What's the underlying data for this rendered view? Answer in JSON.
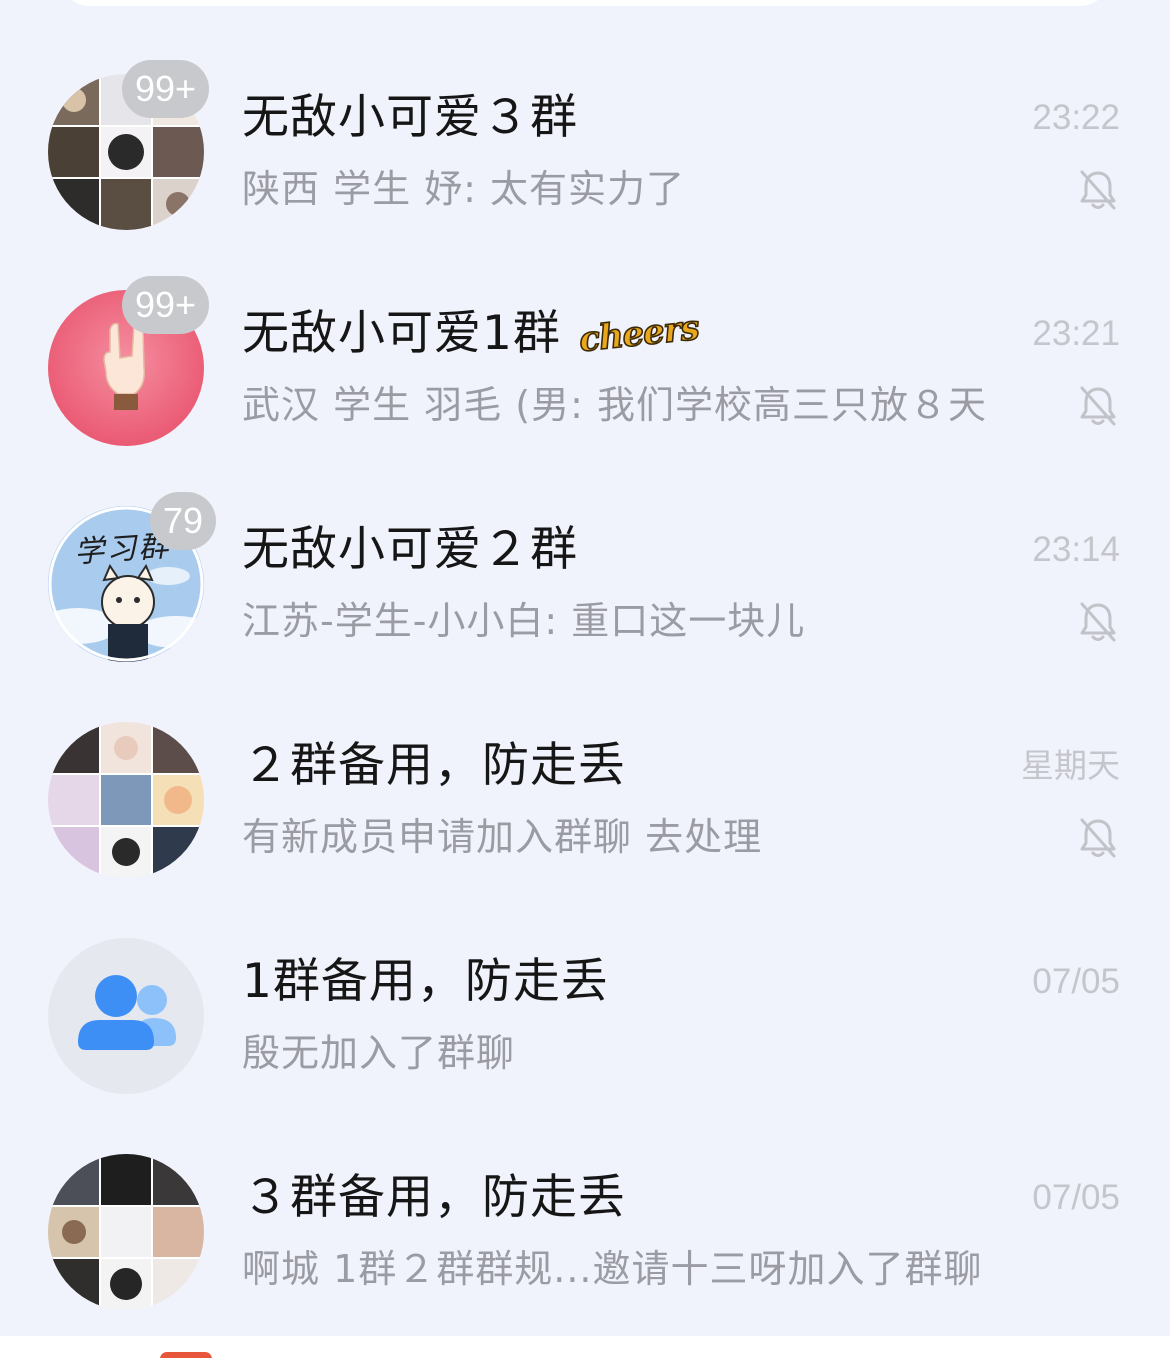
{
  "chats": [
    {
      "title": "无敌小可爱３群",
      "badge": "99+",
      "time": "23:22",
      "preview": "陕西 学生 妤: 太有实力了",
      "muted": true,
      "avatar_icon": "group-collage-avatar"
    },
    {
      "title": "无敌小可爱1群",
      "sticker": "cheers",
      "badge": "99+",
      "time": "23:21",
      "preview": "武汉 学生  羽毛 (男: 我们学校高三只放８天",
      "muted": true,
      "avatar_icon": "rock-hand-avatar"
    },
    {
      "title": "无敌小可爱２群",
      "badge": "79",
      "time": "23:14",
      "preview": "江苏-学生-小小白: 重口这一块儿",
      "muted": true,
      "avatar_icon": "study-group-cat-avatar",
      "avatar_text": "学习群"
    },
    {
      "title": "２群备用，防走丢",
      "time": "星期天",
      "preview": "有新成员申请加入群聊 去处理",
      "muted": true,
      "avatar_icon": "group-collage-avatar"
    },
    {
      "title": "1群备用，防走丢",
      "time": "07/05",
      "preview": "殷无加入了群聊",
      "muted": false,
      "avatar_icon": "default-group-people-icon"
    },
    {
      "title": "３群备用，防走丢",
      "time": "07/05",
      "preview": "啊城 1群２群群规...邀请十三呀加入了群聊",
      "muted": false,
      "avatar_icon": "group-collage-avatar"
    }
  ],
  "colors": {
    "background": "#f1f3fc",
    "title": "#161616",
    "preview": "#9a9ba3",
    "time": "#c5c6cc",
    "badge": "#c8c9cc",
    "group_icon_blue": "#3d8ff5"
  }
}
